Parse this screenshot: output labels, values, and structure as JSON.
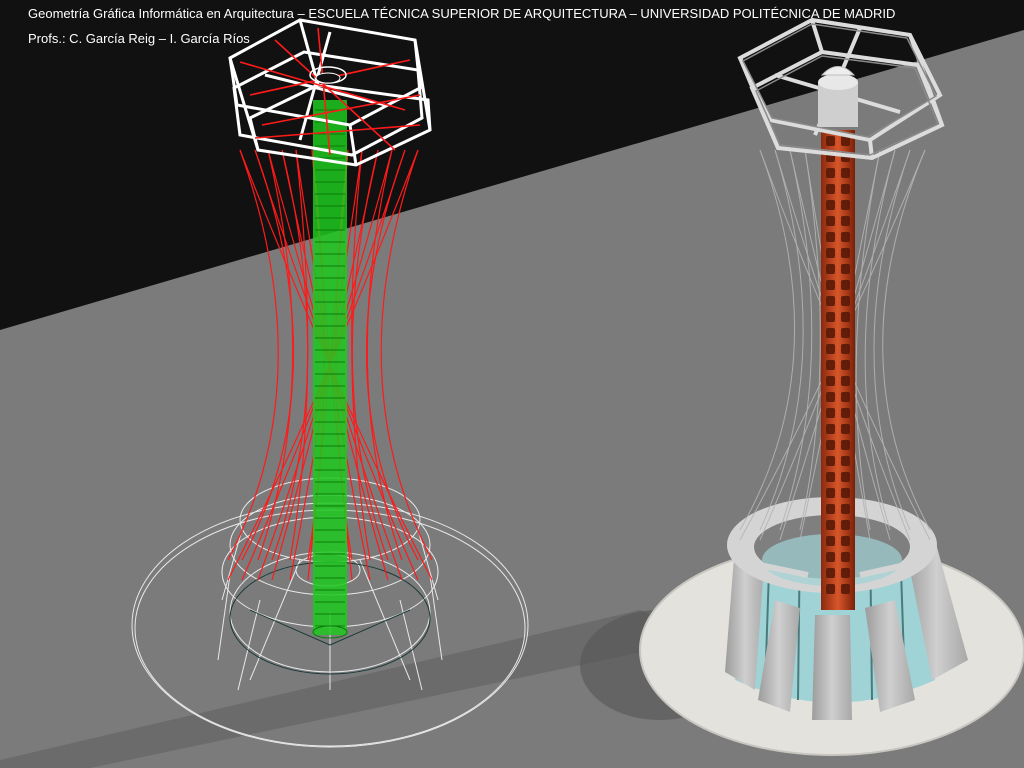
{
  "header": {
    "line1": "Geometría Gráfica Informática en Arquitectura – ESCUELA TÉCNICA SUPERIOR DE ARQUITECTURA – UNIVERSIDAD POLITÉCNICA DE MADRID",
    "line2": "Profs.: C. García Reig – I. García Ríos"
  },
  "scene": {
    "background_color": "#7b7b7b",
    "dark_backdrop_color": "#111111",
    "wireframe_model": {
      "cable_color": "#ff1a1a",
      "core_color": "#22ee22",
      "frame_color": "#ffffff",
      "base_line_color": "#e8e8e8"
    },
    "rendered_model": {
      "core_color": "#c0441f",
      "frame_color": "#dcdcdc",
      "base_color": "#bdbdbd",
      "glass_color": "#9fd3d6",
      "plinth_color": "#e4e2dc",
      "cable_color": "#b4b4b4"
    }
  }
}
